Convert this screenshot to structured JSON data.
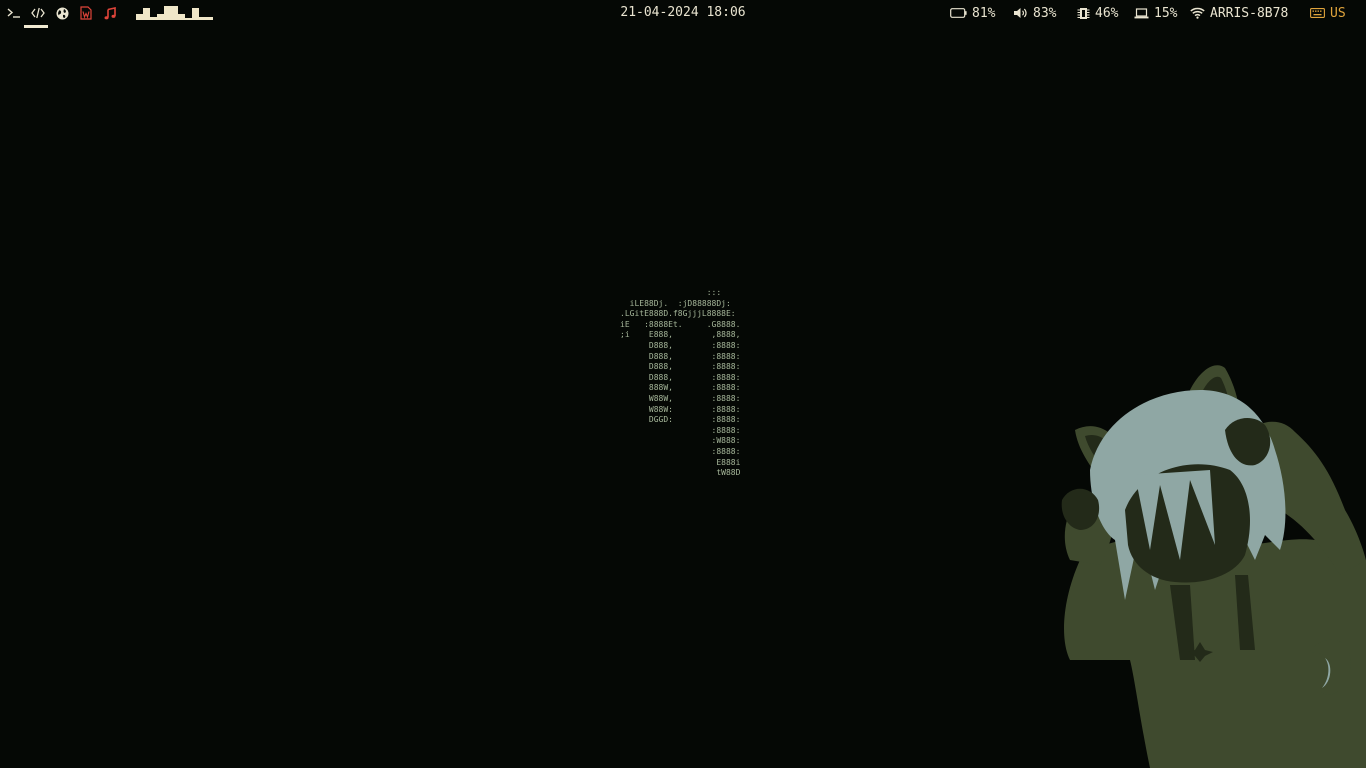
{
  "topbar": {
    "workspaces": [
      {
        "name": "terminal",
        "icon": "terminal-icon",
        "color": "#e9e4d0",
        "active": false
      },
      {
        "name": "code",
        "icon": "code-icon",
        "color": "#e9e4d0",
        "active": true
      },
      {
        "name": "browser",
        "icon": "globe-icon",
        "color": "#e9e4d0",
        "active": false
      },
      {
        "name": "document",
        "icon": "word-document-icon",
        "color": "#e0443a",
        "active": false
      },
      {
        "name": "music",
        "icon": "music-note-icon",
        "color": "#e0443a",
        "active": false
      }
    ],
    "visualizer_levels": [
      0.35,
      0.75,
      0.2,
      0.35,
      0.9,
      0.9,
      0.35,
      0.15,
      0.75,
      0.2,
      0.2
    ],
    "clock": "21-04-2024 18:06",
    "modules": {
      "battery": {
        "icon": "battery-icon",
        "value": "81%"
      },
      "volume": {
        "icon": "speaker-icon",
        "value": "83%"
      },
      "memory": {
        "icon": "memory-icon",
        "value": "46%"
      },
      "cpu": {
        "icon": "laptop-icon",
        "value": "15%"
      },
      "network": {
        "icon": "wifi-icon",
        "value": "ARRIS-8B78"
      },
      "keyboard": {
        "icon": "keyboard-icon",
        "value": "US",
        "color": "#e0a43c"
      }
    }
  },
  "ascii_art": "                  :::\n  iLE88Dj.  :jD88888Dj:\n.LGitE888D.f8GjjjL8888E:\niE   :8888Et.     .G8888.\n;i    E888,        ,8888,\n      D888,        :8888:\n      D888,        :8888:\n      D888,        :8888:\n      D888,        :8888:\n      888W,        :8888:\n      W88W,        :8888:\n      W88W:        :8888:\n      DGGD:        :8888:\n                   :8888:\n                   :W888:\n                   :8888:\n                    E888i\n                    tW88D",
  "colors": {
    "background": "#050805",
    "bar_text": "#e9e4d0",
    "accent_red": "#e0443a",
    "accent_orange": "#e0a43c",
    "ascii": "#a6b79a",
    "figure_dark": "#3f4a2e",
    "figure_hair": "#8fa7a4"
  }
}
